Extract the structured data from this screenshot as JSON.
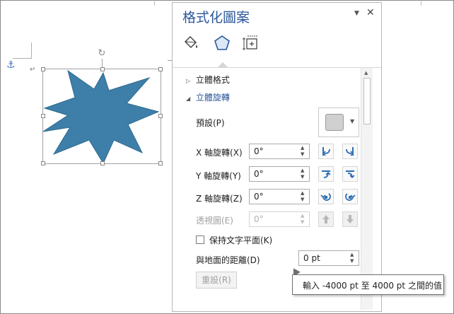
{
  "pane": {
    "title": "格式化圖案",
    "dropdown_icon": "triangle-down-icon",
    "close_icon": "close-icon",
    "tabs": [
      {
        "name": "fill-line",
        "icon": "paint-bucket-icon"
      },
      {
        "name": "effects",
        "icon": "pentagon-icon",
        "selected": true
      },
      {
        "name": "layout-properties",
        "icon": "size-layout-icon"
      }
    ],
    "sections": [
      {
        "label": "立體格式",
        "expanded": false
      },
      {
        "label": "立體旋轉",
        "expanded": true
      }
    ],
    "preset": {
      "label": "預設(P)"
    },
    "x_rotation": {
      "label": "X 軸旋轉(X)",
      "value": "0°"
    },
    "y_rotation": {
      "label": "Y 軸旋轉(Y)",
      "value": "0°"
    },
    "z_rotation": {
      "label": "Z 軸旋轉(Z)",
      "value": "0°"
    },
    "perspective": {
      "label": "透視圖(E)",
      "value": "0°",
      "disabled": true
    },
    "keep_text_flat": {
      "label": "保持文字平面(K)",
      "checked": false
    },
    "distance": {
      "label": "與地面的距離(D)",
      "value": "0 pt"
    },
    "reset": {
      "label": "重設(R)",
      "disabled": true
    }
  },
  "tooltip": {
    "text": "輸入 -4000 pt 至 4000 pt 之間的值"
  },
  "shape": {
    "type": "explosion-star",
    "fill": "#3d7fa8"
  },
  "colors": {
    "accent": "#2b579a",
    "shape_fill": "#3d7fa8",
    "button_icon": "#2e6db4"
  }
}
